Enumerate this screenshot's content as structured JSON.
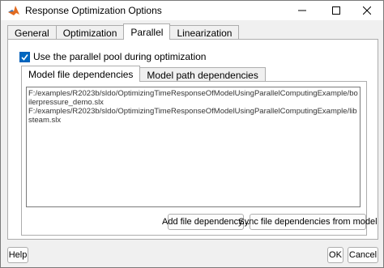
{
  "window": {
    "title": "Response Optimization Options"
  },
  "tabs": [
    {
      "label": "General"
    },
    {
      "label": "Optimization"
    },
    {
      "label": "Parallel"
    },
    {
      "label": "Linearization"
    }
  ],
  "parallel": {
    "use_pool_label": "Use the parallel pool during optimization",
    "use_pool_checked": true,
    "inner_tabs": [
      {
        "label": "Model file dependencies"
      },
      {
        "label": "Model path dependencies"
      }
    ],
    "files": [
      "F:/examples/R2023b/sldo/OptimizingTimeResponseOfModelUsingParallelComputingExample/boilerpressure_demo.slx",
      "F:/examples/R2023b/sldo/OptimizingTimeResponseOfModelUsingParallelComputingExample/libsteam.slx"
    ],
    "add_button": "Add file dependency...",
    "sync_button": "Sync file dependencies from model"
  },
  "footer": {
    "help": "Help",
    "ok": "OK",
    "cancel": "Cancel"
  },
  "colors": {
    "accent": "#0067c0",
    "tab_border": "#adadad"
  }
}
